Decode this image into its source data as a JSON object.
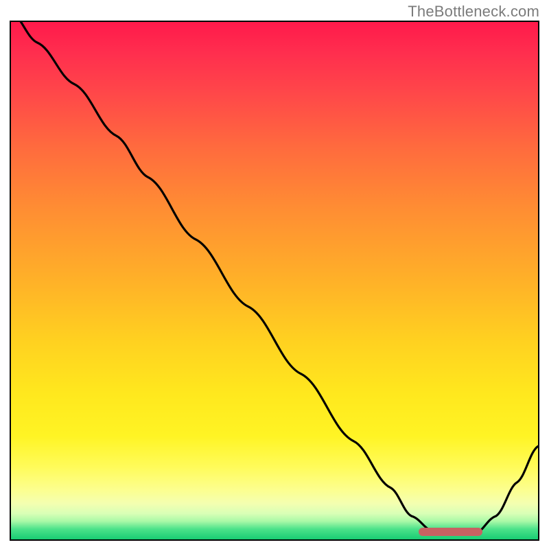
{
  "watermark": "TheBottleneck.com",
  "colors": {
    "border": "#000000",
    "curve": "#000000",
    "marker": "#c86262",
    "watermark_text": "#7b7b7b"
  },
  "chart_data": {
    "type": "line",
    "title": "",
    "xlabel": "",
    "ylabel": "",
    "xlim": [
      0,
      100
    ],
    "ylim": [
      0,
      100
    ],
    "grid": false,
    "x": [
      0,
      5,
      12,
      20,
      26,
      35,
      45,
      55,
      65,
      72,
      76,
      80,
      84,
      88,
      92,
      96,
      100
    ],
    "values": [
      102,
      96,
      88,
      78,
      70,
      58,
      45,
      32,
      19,
      10,
      4.5,
      1.6,
      0.9,
      1.0,
      4.5,
      11,
      18
    ],
    "marker_range_x": [
      77,
      89
    ],
    "annotations": []
  }
}
